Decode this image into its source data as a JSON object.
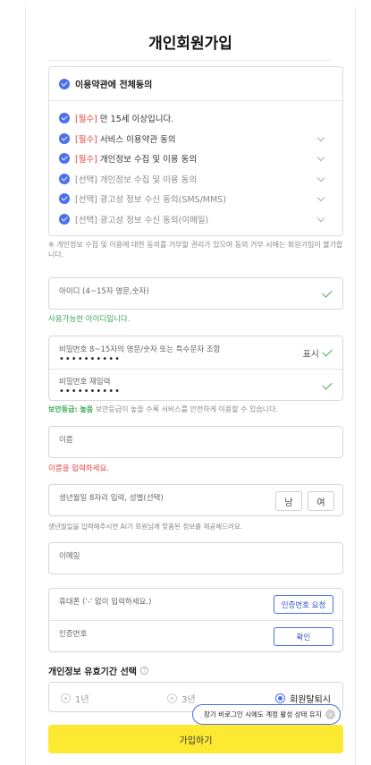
{
  "page": {
    "title": "개인회원가입"
  },
  "terms": {
    "all_label": "이용약관에 전체동의",
    "items": [
      {
        "tag": "",
        "label": "[필수] 만 15세 이상입니다."
      },
      {
        "tag": "[필수]",
        "label": "서비스 이용약관 동의"
      },
      {
        "tag": "[필수]",
        "label": "개인정보 수집 및 이용 동의"
      },
      {
        "tag": "[선택]",
        "label": "개인정보 수집 및 이용 동의"
      },
      {
        "tag": "[선택]",
        "label": "광고성 정보 수신 동의(SMS/MMS)"
      },
      {
        "tag": "[선택]",
        "label": "광고성 정보 수신 동의(이메일)"
      }
    ],
    "notice": "※ 개인정보 수집 및 이용에 대한 동의를 거부할 권리가 있으며 동의 거부 시에는 회원가입이 불가합니다."
  },
  "id_field": {
    "label": "아이디 (4~15자 영문,숫자)",
    "helper": "사용가능한 아이디입니다."
  },
  "password": {
    "label": "비밀번호 8~15자의 영문/숫자 또는 특수문자 조합",
    "value": "••••••••••",
    "show_label": "표시",
    "confirm_label": "비밀번호 재입력",
    "confirm_value": "••••••••••",
    "strength_label": "보안등급: 높음",
    "strength_desc": " 보안등급이 높을 수록 서비스를 안전하게 이용할 수 있습니다."
  },
  "name_field": {
    "label": "이름",
    "error": "이름을 입력하세요."
  },
  "birth_field": {
    "label": "생년월일 8자리 입력, 성별(선택)",
    "male": "남",
    "female": "여",
    "helper": "생년월일을 입력해주시면 AI가 회원님께 맞춤된 정보를 제공해드려요."
  },
  "email_field": {
    "label": "이메일"
  },
  "phone": {
    "label": "휴대폰 ('-' 없이 입력하세요.)",
    "request_button": "인증번호 요청",
    "code_label": "인증번호",
    "confirm_button": "확인"
  },
  "period": {
    "title": "개인정보 유효기간 선택",
    "options": [
      "1년",
      "3년",
      "회원탈퇴시"
    ],
    "selected": "회원탈퇴시",
    "tooltip": "장기 비로그인 시에도 계정 활성 상태 유지"
  },
  "submit_label": "가입하기",
  "colors": {
    "accent_blue": "#4a6ff0",
    "success_green": "#3aa856",
    "error_red": "#e0433c",
    "submit_yellow": "#fde932"
  }
}
